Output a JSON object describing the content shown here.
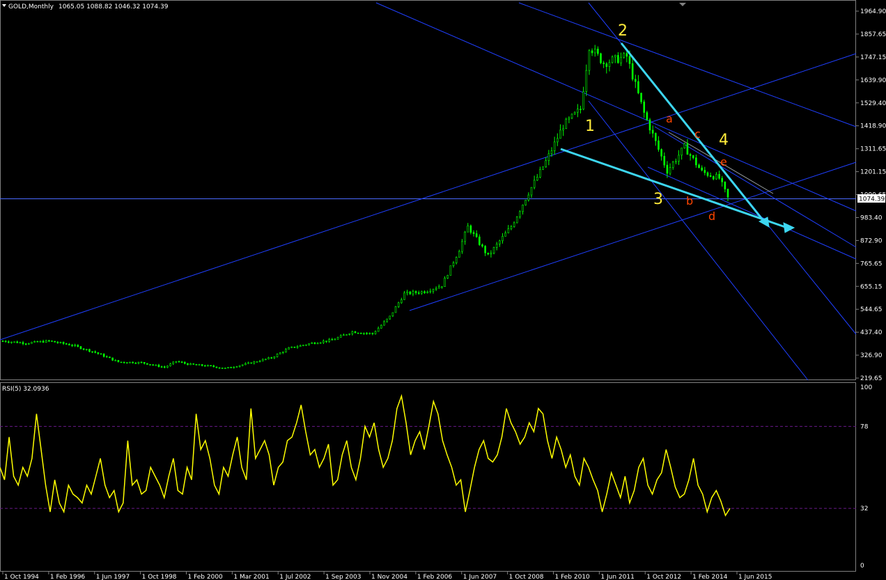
{
  "header": {
    "symbol": "GOLD,Monthly",
    "ohlc": "1065.05 1088.82 1046.32 1074.39",
    "rsi_label": "RSI(5) 32.0936"
  },
  "colors": {
    "background": "#000000",
    "candle": "#00ff00",
    "channel_lines": "#1f3fff",
    "wedge_lines": "#3dd6f0",
    "rsi_line": "#ffff00",
    "rsi_levels": "#6a1a8a",
    "current_price_line": "#4a6aff",
    "wave_labels": "#ffeb3b",
    "sub_wave_labels": "#ff4500"
  },
  "chart_data": [
    {
      "type": "candlestick",
      "title": "GOLD,Monthly",
      "ylim": [
        219.65,
        1964.9
      ],
      "y_ticks": [
        "1964.90",
        "1857.65",
        "1747.15",
        "1639.90",
        "1529.40",
        "1418.90",
        "1311.65",
        "1201.15",
        "1090.65",
        "983.40",
        "872.90",
        "765.65",
        "655.15",
        "544.65",
        "437.40",
        "326.90",
        "219.65"
      ],
      "x_ticks": [
        "1 Oct 1994",
        "1 Feb 1996",
        "1 Jun 1997",
        "1 Oct 1998",
        "1 Feb 2000",
        "1 Mar 2001",
        "1 Jul 2002",
        "1 Sep 2003",
        "1 Nov 2004",
        "1 Feb 2006",
        "1 Jun 2007",
        "1 Oct 2008",
        "1 Feb 2010",
        "1 Jun 2011",
        "1 Oct 2012",
        "1 Feb 2014",
        "1 Jun 2015"
      ],
      "current_price": 1074.39,
      "series": [
        {
          "x": [
            "1994-10",
            "1995-06",
            "1996-02",
            "1996-10",
            "1997-06",
            "1998-02",
            "1998-10",
            "1999-06",
            "1999-10",
            "2000-02",
            "2000-10",
            "2001-03",
            "2001-10",
            "2002-07",
            "2003-01",
            "2003-09",
            "2004-04",
            "2004-11",
            "2005-06",
            "2005-12",
            "2006-05",
            "2006-12",
            "2007-06",
            "2007-12",
            "2008-03",
            "2008-10",
            "2009-06",
            "2009-12",
            "2010-06",
            "2010-12",
            "2011-06",
            "2011-09",
            "2012-02",
            "2012-10",
            "2013-04",
            "2013-12",
            "2014-06",
            "2014-12",
            "2015-06",
            "2015-09"
          ],
          "close": [
            395,
            385,
            395,
            375,
            340,
            295,
            292,
            270,
            298,
            285,
            275,
            265,
            285,
            315,
            360,
            385,
            400,
            440,
            430,
            510,
            620,
            630,
            660,
            830,
            940,
            800,
            940,
            1100,
            1250,
            1420,
            1500,
            1800,
            1720,
            1750,
            1480,
            1205,
            1320,
            1200,
            1170,
            1074
          ]
        }
      ]
    },
    {
      "type": "line",
      "title": "RSI(5) 32.0936",
      "ylim": [
        0,
        100
      ],
      "y_ticks": [
        "100",
        "78",
        "32",
        "0"
      ],
      "levels": [
        78,
        32
      ],
      "series": [
        {
          "name": "RSI(5)",
          "values": [
            55,
            48,
            72,
            50,
            45,
            55,
            50,
            60,
            85,
            65,
            45,
            30,
            48,
            35,
            30,
            45,
            40,
            38,
            35,
            45,
            40,
            50,
            60,
            45,
            38,
            42,
            30,
            35,
            70,
            45,
            48,
            40,
            42,
            55,
            50,
            45,
            38,
            50,
            60,
            42,
            40,
            55,
            48,
            85,
            65,
            70,
            60,
            45,
            40,
            55,
            50,
            62,
            72,
            55,
            48,
            88,
            60,
            65,
            70,
            62,
            45,
            55,
            58,
            70,
            72,
            80,
            90,
            75,
            62,
            65,
            55,
            60,
            68,
            45,
            48,
            62,
            70,
            55,
            48,
            60,
            78,
            72,
            80,
            65,
            55,
            60,
            70,
            88,
            95,
            80,
            62,
            70,
            75,
            65,
            78,
            92,
            85,
            70,
            62,
            55,
            45,
            48,
            30,
            42,
            55,
            65,
            70,
            60,
            58,
            62,
            72,
            88,
            80,
            75,
            68,
            72,
            80,
            75,
            88,
            85,
            70,
            60,
            72,
            65,
            55,
            62,
            50,
            45,
            60,
            55,
            48,
            42,
            30,
            40,
            52,
            45,
            38,
            50,
            35,
            42,
            55,
            60,
            45,
            40,
            48,
            52,
            65,
            55,
            44,
            38,
            40,
            48,
            60,
            45,
            40,
            30,
            38,
            42,
            36,
            28,
            32
          ]
        }
      ]
    }
  ],
  "annotations": {
    "wave_labels": [
      "1",
      "2",
      "3",
      "4"
    ],
    "sub_wave_labels": [
      "a",
      "b",
      "c",
      "d",
      "e"
    ],
    "last_price_label": "1074.39"
  }
}
